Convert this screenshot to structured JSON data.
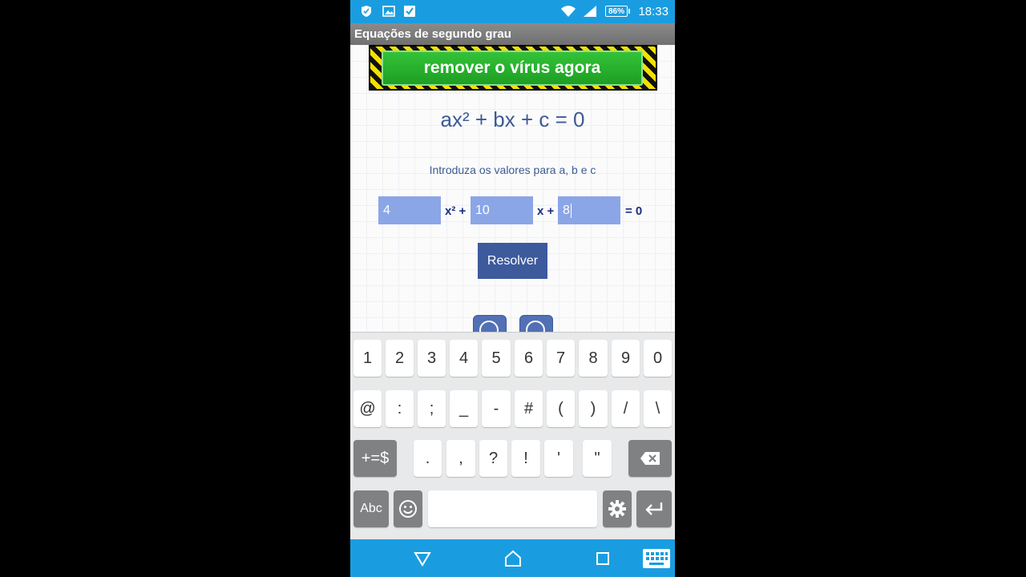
{
  "status_bar": {
    "time": "18:33",
    "battery": "86%",
    "icons": [
      "shield-icon",
      "gallery-icon",
      "check-icon",
      "wifi-icon",
      "signal-icon"
    ]
  },
  "app": {
    "title": "Equações de segundo grau"
  },
  "ad": {
    "text": "remover o vírus agora"
  },
  "main": {
    "equation": "ax² + bx + c = 0",
    "instruction": "Introduza os valores para a, b e c",
    "inputs": {
      "a": "4",
      "b": "10",
      "c": "8"
    },
    "labels": {
      "x2": "x² +",
      "x": "x +",
      "eq": "= 0"
    },
    "solve_button": "Resolver"
  },
  "keyboard": {
    "row1": [
      "1",
      "2",
      "3",
      "4",
      "5",
      "6",
      "7",
      "8",
      "9",
      "0"
    ],
    "row2": [
      "@",
      ":",
      ";",
      "_",
      "-",
      "#",
      "(",
      ")",
      "/",
      "\\"
    ],
    "row3_symbols_key": "+=$",
    "row3": [
      ".",
      ",",
      "?",
      "!",
      "'",
      "\""
    ],
    "row4_abc_key": "Abc"
  },
  "colors": {
    "status_bar": "#1a9de0",
    "accent": "#3d5a9d",
    "input_bg": "#8ba6e6"
  }
}
